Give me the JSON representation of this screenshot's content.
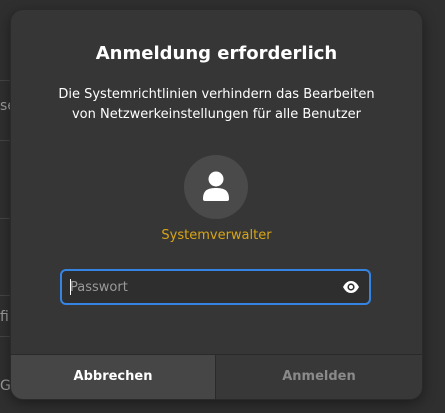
{
  "background": {
    "fragments": [
      "se",
      "fil",
      "Gr"
    ]
  },
  "dialog": {
    "title": "Anmeldung erforderlich",
    "message_line1": "Die Systemrichtlinien verhindern das Bearbeiten",
    "message_line2": "von Netzwerkeinstellungen für alle Benutzer",
    "avatar_icon": "user-icon",
    "username": "Systemverwalter",
    "password": {
      "value": "",
      "placeholder": "Passwort",
      "reveal_icon": "eye-icon"
    },
    "buttons": {
      "cancel": "Abbrechen",
      "login": "Anmelden"
    }
  },
  "colors": {
    "accent": "#3584e4",
    "username": "#d9a514",
    "dialog_bg": "#363636"
  }
}
